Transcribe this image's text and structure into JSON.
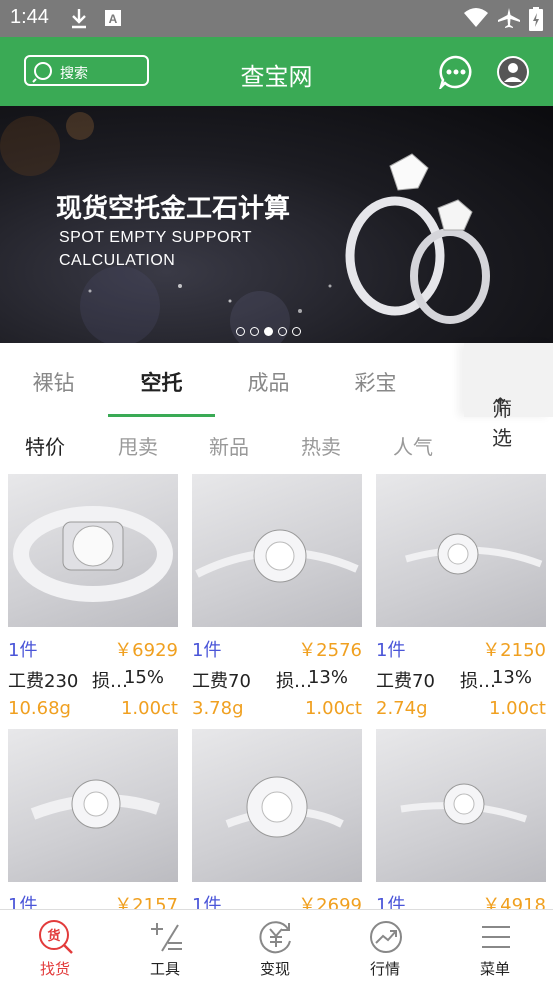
{
  "status_bar": {
    "time": "1:44"
  },
  "header": {
    "search_label": "搜索",
    "title": "查宝网"
  },
  "banner": {
    "title_cn": "现货空托金工石计算",
    "title_en_line1": "SPOT EMPTY SUPPORT",
    "title_en_line2": "CALCULATION",
    "slide_count": 5,
    "active_slide": 3
  },
  "tabs": [
    {
      "label": "裸钻",
      "active": false
    },
    {
      "label": "空托",
      "active": true
    },
    {
      "label": "成品",
      "active": false
    },
    {
      "label": "彩宝",
      "active": false
    }
  ],
  "filter": {
    "label": "筛选"
  },
  "subtabs": [
    {
      "label": "特价",
      "active": true
    },
    {
      "label": "甩卖",
      "active": false
    },
    {
      "label": "新品",
      "active": false
    },
    {
      "label": "热卖",
      "active": false
    },
    {
      "label": "人气",
      "active": false
    }
  ],
  "products": [
    {
      "qty": "1件",
      "price": "￥6929",
      "fee": "工费230",
      "loss_label": "损…",
      "loss": "15%",
      "weight": "10.68g",
      "carat": "1.00ct"
    },
    {
      "qty": "1件",
      "price": "￥2576",
      "fee": "工费70",
      "loss_label": "损…",
      "loss": "13%",
      "weight": "3.78g",
      "carat": "1.00ct"
    },
    {
      "qty": "1件",
      "price": "￥2150",
      "fee": "工费70",
      "loss_label": "损…",
      "loss": "13%",
      "weight": "2.74g",
      "carat": "1.00ct"
    },
    {
      "qty": "1件",
      "price": "￥2157"
    },
    {
      "qty": "1件",
      "price": "￥2699"
    },
    {
      "qty": "1件",
      "price": "￥4918"
    }
  ],
  "bottom_nav": [
    {
      "label": "找货",
      "icon": "find-goods-icon",
      "active": true
    },
    {
      "label": "工具",
      "icon": "tools-icon",
      "active": false
    },
    {
      "label": "变现",
      "icon": "cash-out-icon",
      "active": false
    },
    {
      "label": "行情",
      "icon": "market-trend-icon",
      "active": false
    },
    {
      "label": "菜单",
      "icon": "menu-icon",
      "active": false
    }
  ],
  "colors": {
    "brand_green": "#3aaa55",
    "price_orange": "#f0a020",
    "qty_blue": "#4a55d8",
    "active_red": "#e23b3b"
  }
}
